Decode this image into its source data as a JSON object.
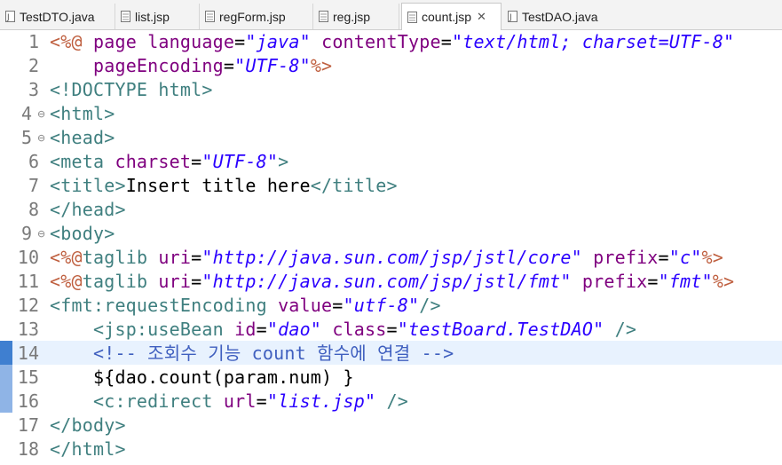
{
  "tabs": [
    {
      "label": "TestDTO.java",
      "icon": "java-file-icon",
      "active": false
    },
    {
      "label": "list.jsp",
      "icon": "jsp-file-icon",
      "active": false
    },
    {
      "label": "regForm.jsp",
      "icon": "jsp-file-icon",
      "active": false
    },
    {
      "label": "reg.jsp",
      "icon": "jsp-file-icon",
      "active": false
    },
    {
      "label": "count.jsp",
      "icon": "jsp-file-icon",
      "active": true,
      "close": "✕"
    },
    {
      "label": "TestDAO.java",
      "icon": "java-file-icon",
      "active": false
    }
  ],
  "editor": {
    "current_line": 14,
    "lines": [
      {
        "num": "1"
      },
      {
        "num": "2"
      },
      {
        "num": "3"
      },
      {
        "num": "4",
        "fold": "⊖"
      },
      {
        "num": "5",
        "fold": "⊖"
      },
      {
        "num": "6"
      },
      {
        "num": "7"
      },
      {
        "num": "8"
      },
      {
        "num": "9",
        "fold": "⊖"
      },
      {
        "num": "10"
      },
      {
        "num": "11"
      },
      {
        "num": "12"
      },
      {
        "num": "13"
      },
      {
        "num": "14"
      },
      {
        "num": "15"
      },
      {
        "num": "16"
      },
      {
        "num": "17"
      },
      {
        "num": "18"
      }
    ],
    "code": {
      "l1": [
        "<%@",
        " page ",
        "language",
        "=",
        "\"java\"",
        " ",
        "contentType",
        "=",
        "\"text/html; charset=UTF-8\""
      ],
      "l2": [
        "    ",
        "pageEncoding",
        "=",
        "\"UTF-8\"",
        "%>"
      ],
      "l3": [
        "<!DOCTYPE ",
        "html",
        ">"
      ],
      "l4": [
        "<html>"
      ],
      "l5": [
        "<head>"
      ],
      "l6": [
        "<meta ",
        "charset",
        "=",
        "\"UTF-8\"",
        ">"
      ],
      "l7": [
        "<title>",
        "Insert title here",
        "</title>"
      ],
      "l8": [
        "</head>"
      ],
      "l9": [
        "<body>"
      ],
      "l10": [
        "<%@",
        "taglib ",
        "uri",
        "=",
        "\"http://java.sun.com/jsp/jstl/core\"",
        " ",
        "prefix",
        "=",
        "\"c\"",
        "%>"
      ],
      "l11": [
        "<%@",
        "taglib ",
        "uri",
        "=",
        "\"http://java.sun.com/jsp/jstl/fmt\"",
        " ",
        "prefix",
        "=",
        "\"fmt\"",
        "%>"
      ],
      "l12": [
        "<fmt:requestEncoding ",
        "value",
        "=",
        "\"utf-8\"",
        "/>"
      ],
      "l13": [
        "    ",
        "<jsp:useBean ",
        "id",
        "=",
        "\"dao\"",
        " ",
        "class",
        "=",
        "\"testBoard.TestDAO\"",
        " />"
      ],
      "l14": [
        "    ",
        "<!-- 조회수 기능 count 함수에 연결 -->"
      ],
      "l15": [
        "    ",
        "${dao.count(param.num) }"
      ],
      "l16": [
        "    ",
        "<c:redirect ",
        "url",
        "=",
        "\"list.jsp\"",
        " />"
      ],
      "l17": [
        "</body>"
      ],
      "l18": [
        "</html>"
      ]
    }
  },
  "colors": {
    "tag": "#3f7f7f",
    "attribute": "#7f007f",
    "string": "#2a00ff",
    "jsp_delimiter": "#bf5f3f",
    "comment": "#3f5fbf",
    "current_line": "#e8f2fe"
  }
}
